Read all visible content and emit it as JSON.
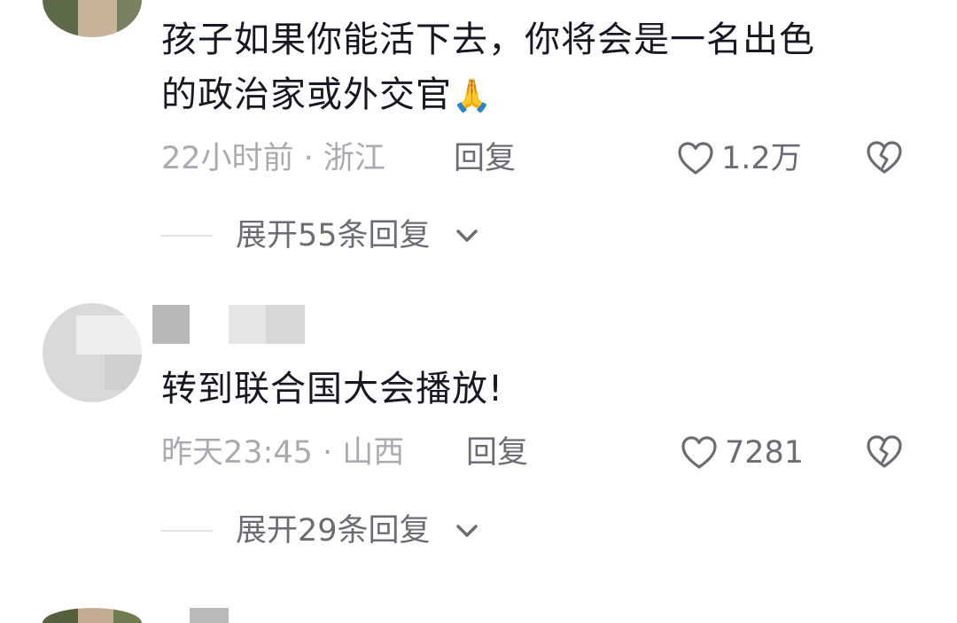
{
  "comments": [
    {
      "text_line1": "孩子如果你能活下去，你将会是一名出色",
      "text_line2": "的政治家或外交官",
      "emoji": "🙏",
      "time": "22小时前 · 浙江",
      "reply_label": "回复",
      "like_count": "1.2万",
      "expand_label": "展开55条回复"
    },
    {
      "text": "转到联合国大会播放!",
      "time": "昨天23:45 · 山西",
      "reply_label": "回复",
      "like_count": "7281",
      "expand_label": "展开29条回复"
    }
  ],
  "icons": {
    "like": "heart-outline-icon",
    "dislike": "broken-heart-icon",
    "expand": "chevron-down-icon"
  },
  "colors": {
    "text": "#161823",
    "meta": "#a9abb1",
    "action": "#6b6d74"
  }
}
